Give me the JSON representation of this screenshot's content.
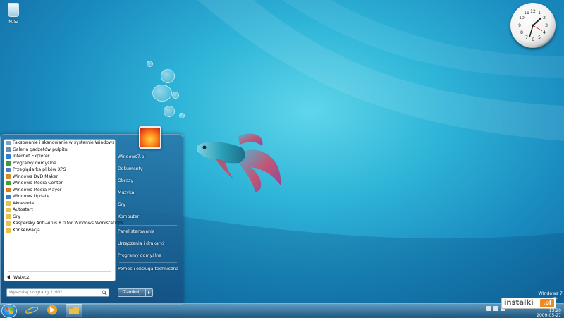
{
  "desktop": {
    "recycle_bin_label": "Kosz",
    "os_badge": "Windows 7",
    "os_build": "To..."
  },
  "start_menu": {
    "programs": [
      {
        "label": "Faksowanie i skanowanie w systemie Windows",
        "icon": "fax-icon",
        "color": "#7aa0c8"
      },
      {
        "label": "Galeria gadżetów pulpitu",
        "icon": "gadgets-icon",
        "color": "#6a8fb0"
      },
      {
        "label": "Internet Explorer",
        "icon": "ie-icon",
        "color": "#2a7fd4"
      },
      {
        "label": "Programy domyślne",
        "icon": "default-programs-icon",
        "color": "#3c9a3c"
      },
      {
        "label": "Przeglądarka plików XPS",
        "icon": "xps-icon",
        "color": "#4a7fc0"
      },
      {
        "label": "Windows DVD Maker",
        "icon": "dvd-maker-icon",
        "color": "#d68a2a"
      },
      {
        "label": "Windows Media Center",
        "icon": "media-center-icon",
        "color": "#3da03d"
      },
      {
        "label": "Windows Media Player",
        "icon": "media-player-icon",
        "color": "#e07a1e"
      },
      {
        "label": "Windows Update",
        "icon": "windows-update-icon",
        "color": "#3a7cc4"
      },
      {
        "label": "Akcesoria",
        "icon": "folder-icon",
        "color": "#e8c04a"
      },
      {
        "label": "Autostart",
        "icon": "folder-icon",
        "color": "#e8c04a"
      },
      {
        "label": "Gry",
        "icon": "folder-icon",
        "color": "#e8c04a"
      },
      {
        "label": "Kaspersky Anti-Virus 8.0 for Windows Workstations",
        "icon": "folder-icon",
        "color": "#e8c04a"
      },
      {
        "label": "Konserwacja",
        "icon": "folder-icon",
        "color": "#e8c04a"
      }
    ],
    "back_label": "Wstecz",
    "search_placeholder": "Wyszukaj programy i pliki",
    "right_items": [
      {
        "label": "Windows7.pl"
      },
      {
        "label": "Dokumenty"
      },
      {
        "label": "Obrazy"
      },
      {
        "label": "Muzyka"
      },
      {
        "label": "Gry"
      },
      {
        "label": "Komputer"
      },
      {
        "label": "Panel sterowania"
      },
      {
        "label": "Urządzenia i drukarki"
      },
      {
        "label": "Programy domyślne"
      },
      {
        "label": "Pomoc i obsługa techniczna"
      }
    ],
    "shutdown_label": "Zamknij"
  },
  "taskbar": {
    "date": "2009-05-27",
    "time": "13:20"
  },
  "watermark": {
    "text": "instalki",
    "suffix": ".pl"
  },
  "colors": {
    "accent": "#1a8cc0",
    "start_menu": "#2878aa"
  }
}
